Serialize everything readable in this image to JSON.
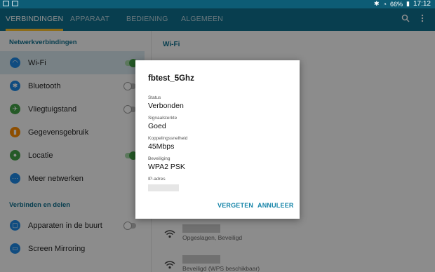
{
  "statusbar": {
    "battery": "66%",
    "time": "17:12",
    "left_icons": [
      "sim-icon",
      "image-icon"
    ]
  },
  "tabs": [
    "VERBINDINGEN",
    "APPARAAT",
    "BEDIENING",
    "ALGEMEEN"
  ],
  "toolbar_icons": [
    "search-icon",
    "more-vert-icon"
  ],
  "sidebar": {
    "section1": "Netwerkverbindingen",
    "items1": [
      {
        "label": "Wi-Fi",
        "icon": "wifi-icon",
        "toggle": "on",
        "color": "#1e88e5"
      },
      {
        "label": "Bluetooth",
        "icon": "bluetooth-icon",
        "toggle": "off",
        "color": "#1e88e5"
      },
      {
        "label": "Vliegtuigstand",
        "icon": "airplane-icon",
        "toggle": "off",
        "color": "#43a047"
      },
      {
        "label": "Gegevensgebruik",
        "icon": "data-usage-icon",
        "toggle": null,
        "color": "#fb8c00"
      },
      {
        "label": "Locatie",
        "icon": "location-icon",
        "toggle": "on",
        "color": "#43a047"
      },
      {
        "label": "Meer netwerken",
        "icon": "more-networks-icon",
        "toggle": null,
        "color": "#1e88e5"
      }
    ],
    "section2": "Verbinden en delen",
    "items2": [
      {
        "label": "Apparaten in de buurt",
        "icon": "nearby-devices-icon",
        "toggle": "off",
        "color": "#1e88e5"
      },
      {
        "label": "Screen Mirroring",
        "icon": "screen-mirroring-icon",
        "toggle": null,
        "color": "#1e88e5"
      }
    ]
  },
  "main": {
    "title": "Wi-Fi",
    "networks": [
      {
        "sub": "Opgeslagen, Beveiligd"
      },
      {
        "sub": "Beveiligd (WPS beschikbaar)"
      }
    ]
  },
  "dialog": {
    "title": "fbtest_5Ghz",
    "fields": [
      {
        "label": "Status",
        "value": "Verbonden"
      },
      {
        "label": "Signaalsterkte",
        "value": "Goed"
      },
      {
        "label": "Koppelingssnelheid",
        "value": "45Mbps"
      },
      {
        "label": "Beveiliging",
        "value": "WPA2 PSK"
      },
      {
        "label": "IP-adres",
        "value": ""
      }
    ],
    "forget_label": "VERGETEN",
    "cancel_label": "ANNULEER"
  },
  "colors": {
    "accent": "#0f6f8d",
    "tab_indicator": "#fbc02d",
    "toggle_on": "#43a047",
    "button": "#1584a8"
  }
}
